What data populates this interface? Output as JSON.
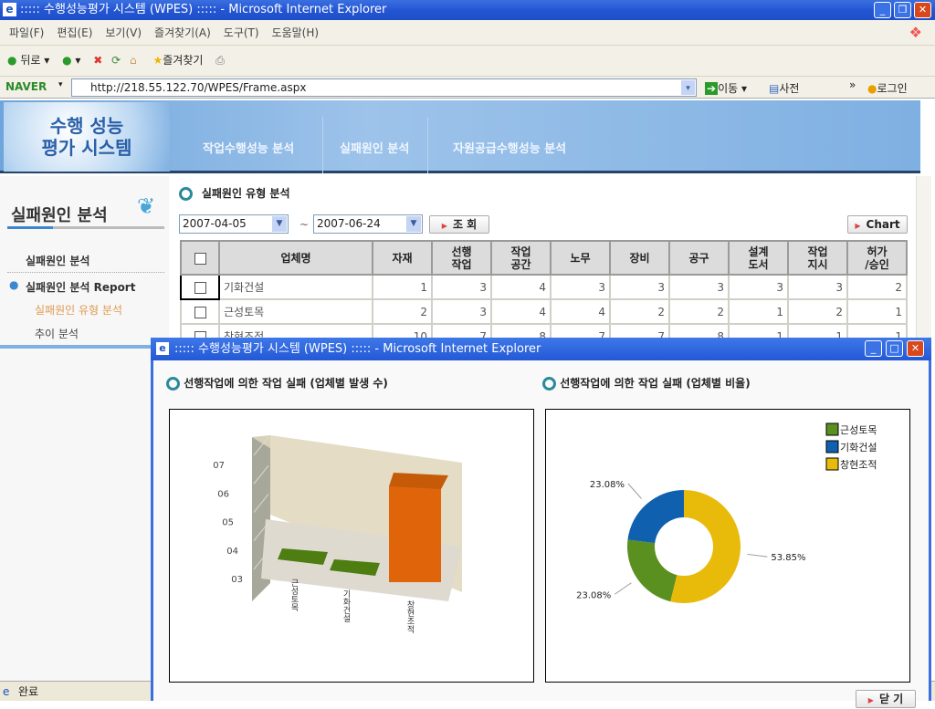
{
  "window": {
    "title": ":::::  수행성능평가 시스템 (WPES) :::::  - Microsoft Internet Explorer"
  },
  "menu": [
    "파일(F)",
    "편집(E)",
    "보기(V)",
    "즐겨찾기(A)",
    "도구(T)",
    "도움말(H)"
  ],
  "toolbar": {
    "back": "뒤로",
    "favorites": "즐겨찾기"
  },
  "address": {
    "brand": "NAVER",
    "url": "http://218.55.122.70/WPES/Frame.aspx",
    "go": "이동",
    "dictionary": "사전",
    "login": "로그인"
  },
  "site": {
    "logo": "수행 성능\n평가 시스템",
    "nav": [
      "작업수행성능 분석",
      "실패원인 분석",
      "자원공급수행성능 분석"
    ]
  },
  "sidebar": {
    "title": "실패원인 분석",
    "items": [
      "실패원인 분석",
      "실패원인 분석 Report",
      "실패원인 유형 분석",
      "추이 분석"
    ]
  },
  "main": {
    "section_title": "실패원인 유형 분석",
    "date_from": "2007-04-05",
    "date_to": "2007-06-24",
    "tilde": "~",
    "search_label": "조 회",
    "chart_label": "Chart",
    "columns": [
      "업체명",
      "자재",
      "선행\n작업",
      "작업\n공간",
      "노무",
      "장비",
      "공구",
      "설계\n도서",
      "작업\n지시",
      "허가\n/승인"
    ],
    "rows": [
      {
        "name": "기화건설",
        "values": [
          1,
          3,
          4,
          3,
          3,
          3,
          3,
          3,
          2
        ]
      },
      {
        "name": "근성토목",
        "values": [
          2,
          3,
          4,
          4,
          2,
          2,
          1,
          2,
          1
        ]
      },
      {
        "name": "창현조적",
        "values": [
          10,
          7,
          8,
          7,
          7,
          8,
          1,
          1,
          1
        ]
      }
    ]
  },
  "status": {
    "text": "완료"
  },
  "popup": {
    "title": ":::::  수행성능평가 시스템 (WPES) :::::  - Microsoft Internet Explorer",
    "left_title": "선행작업에 의한 작업 실패 (업체별 발생 수)",
    "right_title": "선행작업에 의한 작업 실패 (업체별 비율)",
    "close_label": "닫 기"
  },
  "chart_data": [
    {
      "type": "bar",
      "categories": [
        "근성토목",
        "기화건설",
        "창현조적"
      ],
      "values": [
        3,
        3,
        7
      ],
      "yticks": [
        "03",
        "04",
        "05",
        "06",
        "07"
      ],
      "ylim": [
        3,
        7
      ],
      "colors": [
        "#4e7d12",
        "#4e7d12",
        "#e0650a"
      ],
      "style": "3d"
    },
    {
      "type": "pie",
      "donut": true,
      "legend": "top-right",
      "series": [
        {
          "name": "근성토목",
          "value": 3,
          "label": "23.08%",
          "color": "#5a9020"
        },
        {
          "name": "기화건설",
          "value": 3,
          "label": "23.08%",
          "color": "#1060b0"
        },
        {
          "name": "창현조적",
          "value": 7,
          "label": "53.85%",
          "color": "#e8bb0a"
        }
      ]
    }
  ]
}
